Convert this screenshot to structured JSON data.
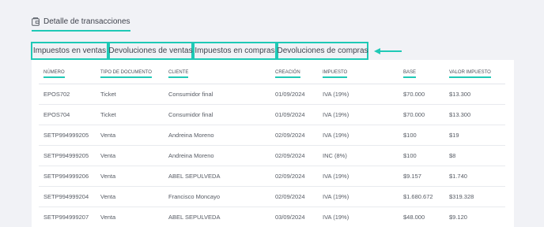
{
  "header": {
    "title": "Detalle de transacciones",
    "icon": "wallet-icon"
  },
  "tabs": [
    {
      "label": "Impuestos en ventas"
    },
    {
      "label": "Devoluciones de ventas"
    },
    {
      "label": "Impuestos en compras"
    },
    {
      "label": "Devoluciones de compras"
    }
  ],
  "accent_color": "#1fc9b6",
  "table": {
    "columns": [
      "NÚMERO",
      "TIPO DE DOCUMENTO",
      "CLIENTE",
      "CREACIÓN",
      "IMPUESTO",
      "BASE",
      "VALOR IMPUESTO"
    ],
    "rows": [
      [
        "EPOS702",
        "Ticket",
        "Consumidor final",
        "01/09/2024",
        "IVA (19%)",
        "$70.000",
        "$13.300"
      ],
      [
        "EPOS704",
        "Ticket",
        "Consumidor final",
        "01/09/2024",
        "IVA (19%)",
        "$70.000",
        "$13.300"
      ],
      [
        "SETP994999205",
        "Venta",
        "Andreina Moreno",
        "02/09/2024",
        "IVA (19%)",
        "$100",
        "$19"
      ],
      [
        "SETP994999205",
        "Venta",
        "Andreina Moreno",
        "02/09/2024",
        "INC (8%)",
        "$100",
        "$8"
      ],
      [
        "SETP994999206",
        "Venta",
        "ABEL SEPULVEDA",
        "02/09/2024",
        "IVA (19%)",
        "$9.157",
        "$1.740"
      ],
      [
        "SETP994999204",
        "Venta",
        "Francisco Moncayo",
        "02/09/2024",
        "IVA (19%)",
        "$1.680.672",
        "$319.328"
      ],
      [
        "SETP994999207",
        "Venta",
        "ABEL SEPULVEDA",
        "03/09/2024",
        "IVA (19%)",
        "$48.000",
        "$9.120"
      ]
    ]
  }
}
